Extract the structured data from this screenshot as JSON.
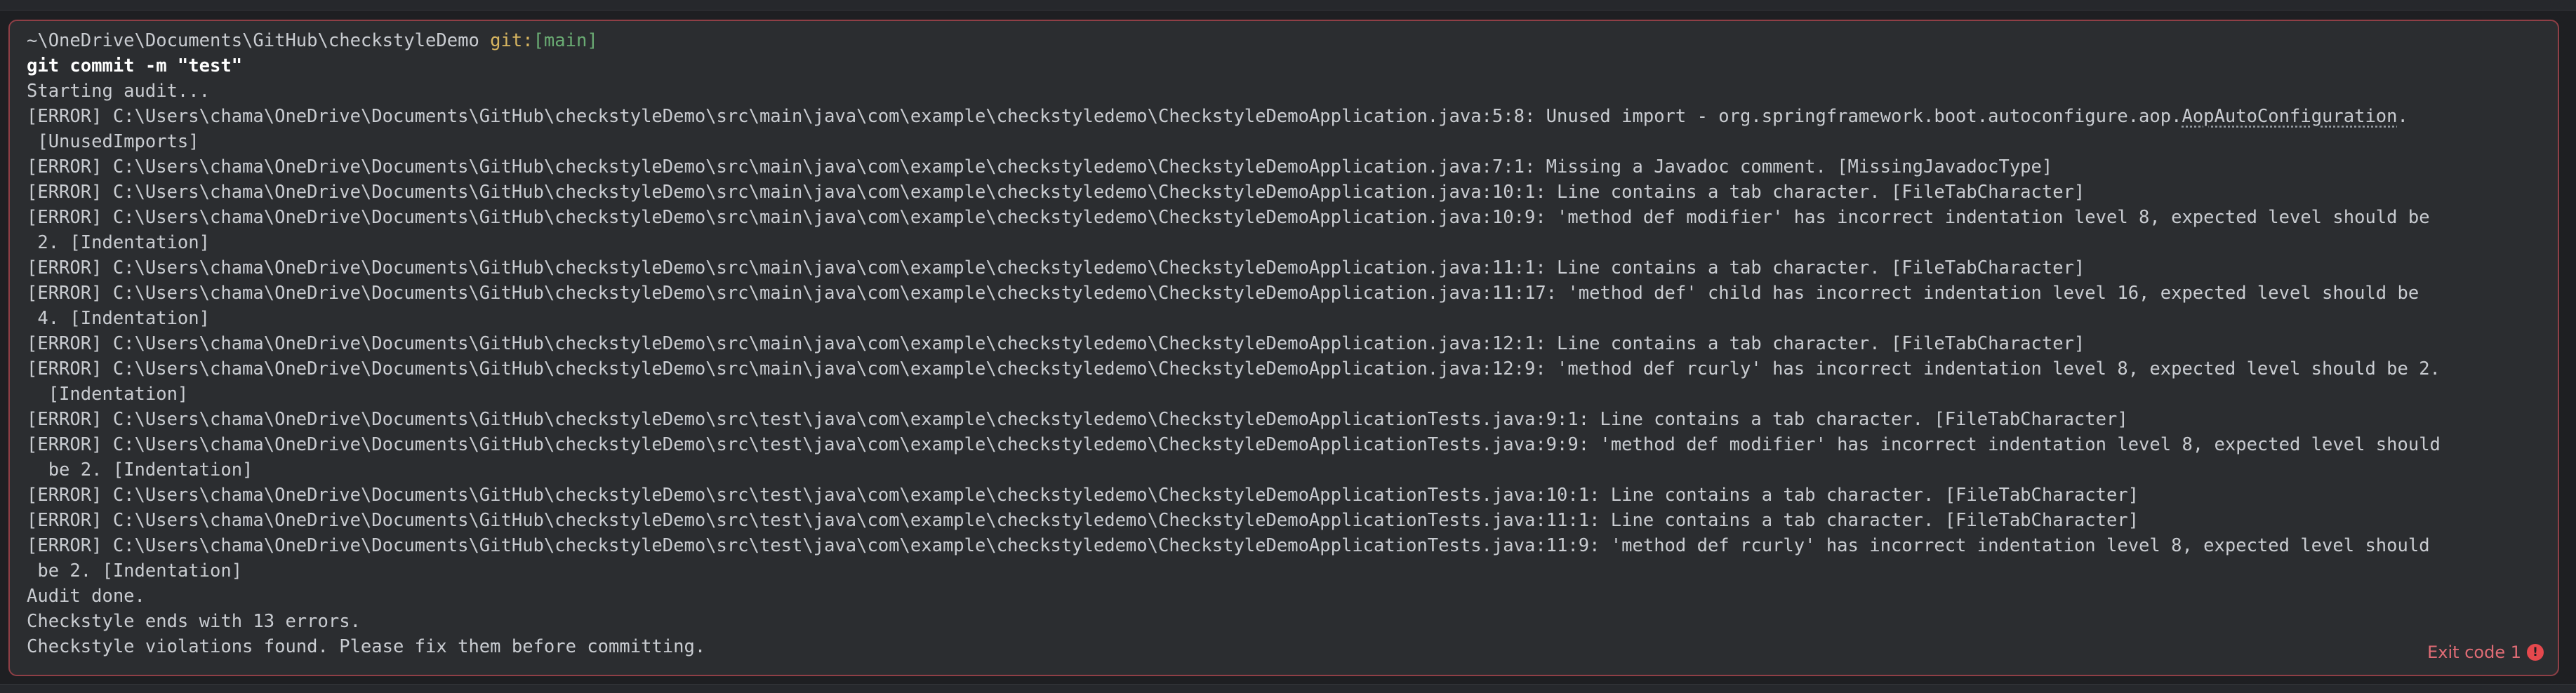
{
  "prompt": {
    "path": "~\\OneDrive\\Documents\\GitHub\\checkstyleDemo",
    "git_label": "git:",
    "branch": "[main]"
  },
  "command": "git commit -m \"test\"",
  "output": {
    "starting": "Starting audit...",
    "lines": [
      "[ERROR] C:\\Users\\chama\\OneDrive\\Documents\\GitHub\\checkstyleDemo\\src\\main\\java\\com\\example\\checkstyledemo\\CheckstyleDemoApplication.java:5:8: Unused import - org.springframework.boot.autoconfigure.aop.",
      "AopAutoConfiguration",
      ".",
      " [UnusedImports]",
      "[ERROR] C:\\Users\\chama\\OneDrive\\Documents\\GitHub\\checkstyleDemo\\src\\main\\java\\com\\example\\checkstyledemo\\CheckstyleDemoApplication.java:7:1: Missing a Javadoc comment. [MissingJavadocType]",
      "[ERROR] C:\\Users\\chama\\OneDrive\\Documents\\GitHub\\checkstyleDemo\\src\\main\\java\\com\\example\\checkstyledemo\\CheckstyleDemoApplication.java:10:1: Line contains a tab character. [FileTabCharacter]",
      "[ERROR] C:\\Users\\chama\\OneDrive\\Documents\\GitHub\\checkstyleDemo\\src\\main\\java\\com\\example\\checkstyledemo\\CheckstyleDemoApplication.java:10:9: 'method def modifier' has incorrect indentation level 8, expected level should be",
      " 2. [Indentation]",
      "[ERROR] C:\\Users\\chama\\OneDrive\\Documents\\GitHub\\checkstyleDemo\\src\\main\\java\\com\\example\\checkstyledemo\\CheckstyleDemoApplication.java:11:1: Line contains a tab character. [FileTabCharacter]",
      "[ERROR] C:\\Users\\chama\\OneDrive\\Documents\\GitHub\\checkstyleDemo\\src\\main\\java\\com\\example\\checkstyledemo\\CheckstyleDemoApplication.java:11:17: 'method def' child has incorrect indentation level 16, expected level should be",
      " 4. [Indentation]",
      "[ERROR] C:\\Users\\chama\\OneDrive\\Documents\\GitHub\\checkstyleDemo\\src\\main\\java\\com\\example\\checkstyledemo\\CheckstyleDemoApplication.java:12:1: Line contains a tab character. [FileTabCharacter]",
      "[ERROR] C:\\Users\\chama\\OneDrive\\Documents\\GitHub\\checkstyleDemo\\src\\main\\java\\com\\example\\checkstyledemo\\CheckstyleDemoApplication.java:12:9: 'method def rcurly' has incorrect indentation level 8, expected level should be 2.",
      "  [Indentation]",
      "[ERROR] C:\\Users\\chama\\OneDrive\\Documents\\GitHub\\checkstyleDemo\\src\\test\\java\\com\\example\\checkstyledemo\\CheckstyleDemoApplicationTests.java:9:1: Line contains a tab character. [FileTabCharacter]",
      "[ERROR] C:\\Users\\chama\\OneDrive\\Documents\\GitHub\\checkstyleDemo\\src\\test\\java\\com\\example\\checkstyledemo\\CheckstyleDemoApplicationTests.java:9:9: 'method def modifier' has incorrect indentation level 8, expected level should",
      "  be 2. [Indentation]",
      "[ERROR] C:\\Users\\chama\\OneDrive\\Documents\\GitHub\\checkstyleDemo\\src\\test\\java\\com\\example\\checkstyledemo\\CheckstyleDemoApplicationTests.java:10:1: Line contains a tab character. [FileTabCharacter]",
      "[ERROR] C:\\Users\\chama\\OneDrive\\Documents\\GitHub\\checkstyleDemo\\src\\test\\java\\com\\example\\checkstyledemo\\CheckstyleDemoApplicationTests.java:11:1: Line contains a tab character. [FileTabCharacter]",
      "[ERROR] C:\\Users\\chama\\OneDrive\\Documents\\GitHub\\checkstyleDemo\\src\\test\\java\\com\\example\\checkstyledemo\\CheckstyleDemoApplicationTests.java:11:9: 'method def rcurly' has incorrect indentation level 8, expected level should",
      " be 2. [Indentation]",
      "Audit done.",
      "Checkstyle ends with 13 errors.",
      "Checkstyle violations found. Please fix them before committing."
    ]
  },
  "exit": {
    "label": "Exit code 1",
    "icon": "!",
    "color": "#e06c75"
  }
}
